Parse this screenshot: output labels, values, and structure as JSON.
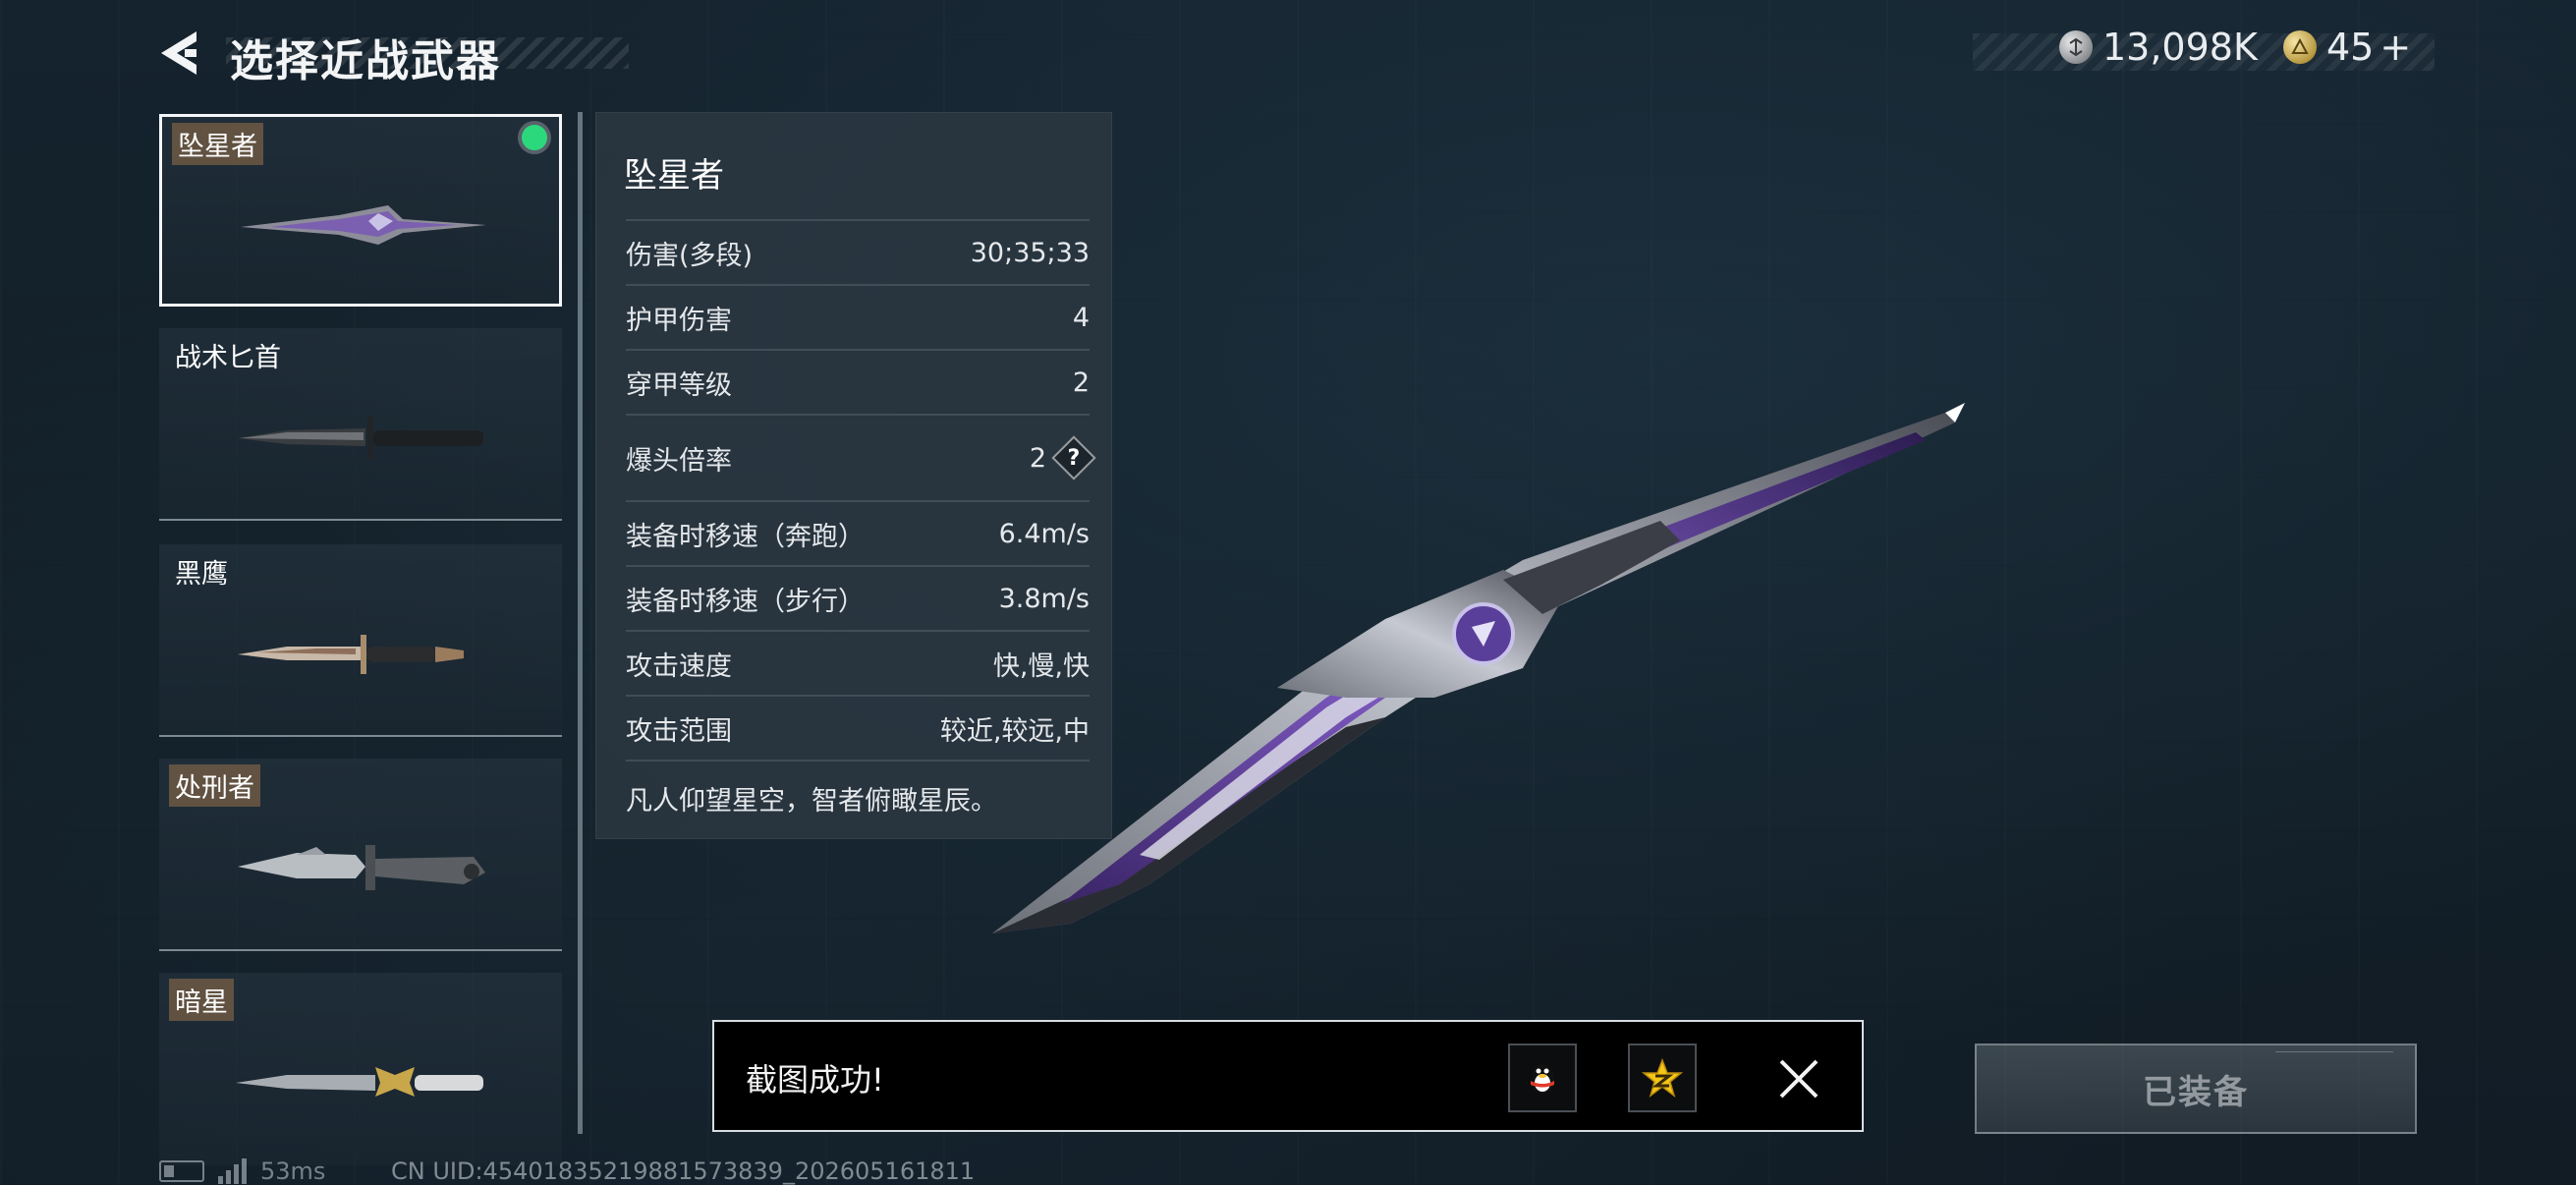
{
  "header": {
    "title": "选择近战武器",
    "currency_silver": "13,098K",
    "currency_gold": "45",
    "currency_gold_plus": "+"
  },
  "weapons": [
    {
      "name": "坠星者",
      "selected": true,
      "equipped": true
    },
    {
      "name": "战术匕首",
      "selected": false
    },
    {
      "name": "黑鹰",
      "selected": false
    },
    {
      "name": "处刑者",
      "selected": false
    },
    {
      "name": "暗星",
      "selected": false
    }
  ],
  "details": {
    "title": "坠星者",
    "stats": [
      {
        "label": "伤害(多段)",
        "value": "30;35;33"
      },
      {
        "label": "护甲伤害",
        "value": "4"
      },
      {
        "label": "穿甲等级",
        "value": "2"
      },
      {
        "label": "爆头倍率",
        "value": "2",
        "help": "?"
      },
      {
        "label": "装备时移速（奔跑）",
        "value": "6.4m/s"
      },
      {
        "label": "装备时移速（步行）",
        "value": "3.8m/s"
      },
      {
        "label": "攻击速度",
        "value": "快,慢,快"
      },
      {
        "label": "攻击范围",
        "value": "较近,较远,中"
      }
    ],
    "flavor_text": "凡人仰望星空，智者俯瞰星辰。"
  },
  "toast": {
    "message": "截图成功!"
  },
  "equip_button": {
    "label": "已装备"
  },
  "status_bar": {
    "ping": "53ms",
    "uid": "CN UID:454018352198815738­39_202605161811"
  },
  "colors": {
    "equipped_dot": "#2bd97c",
    "panel": "#2c3842",
    "background": "#132029"
  },
  "icons": {
    "back": "back-arrow-icon",
    "silver_coin": "silver-coin-icon",
    "gold_coin": "gold-coin-icon",
    "qq": "qq-penguin-icon",
    "qzone": "qzone-star-icon",
    "close": "close-icon"
  }
}
